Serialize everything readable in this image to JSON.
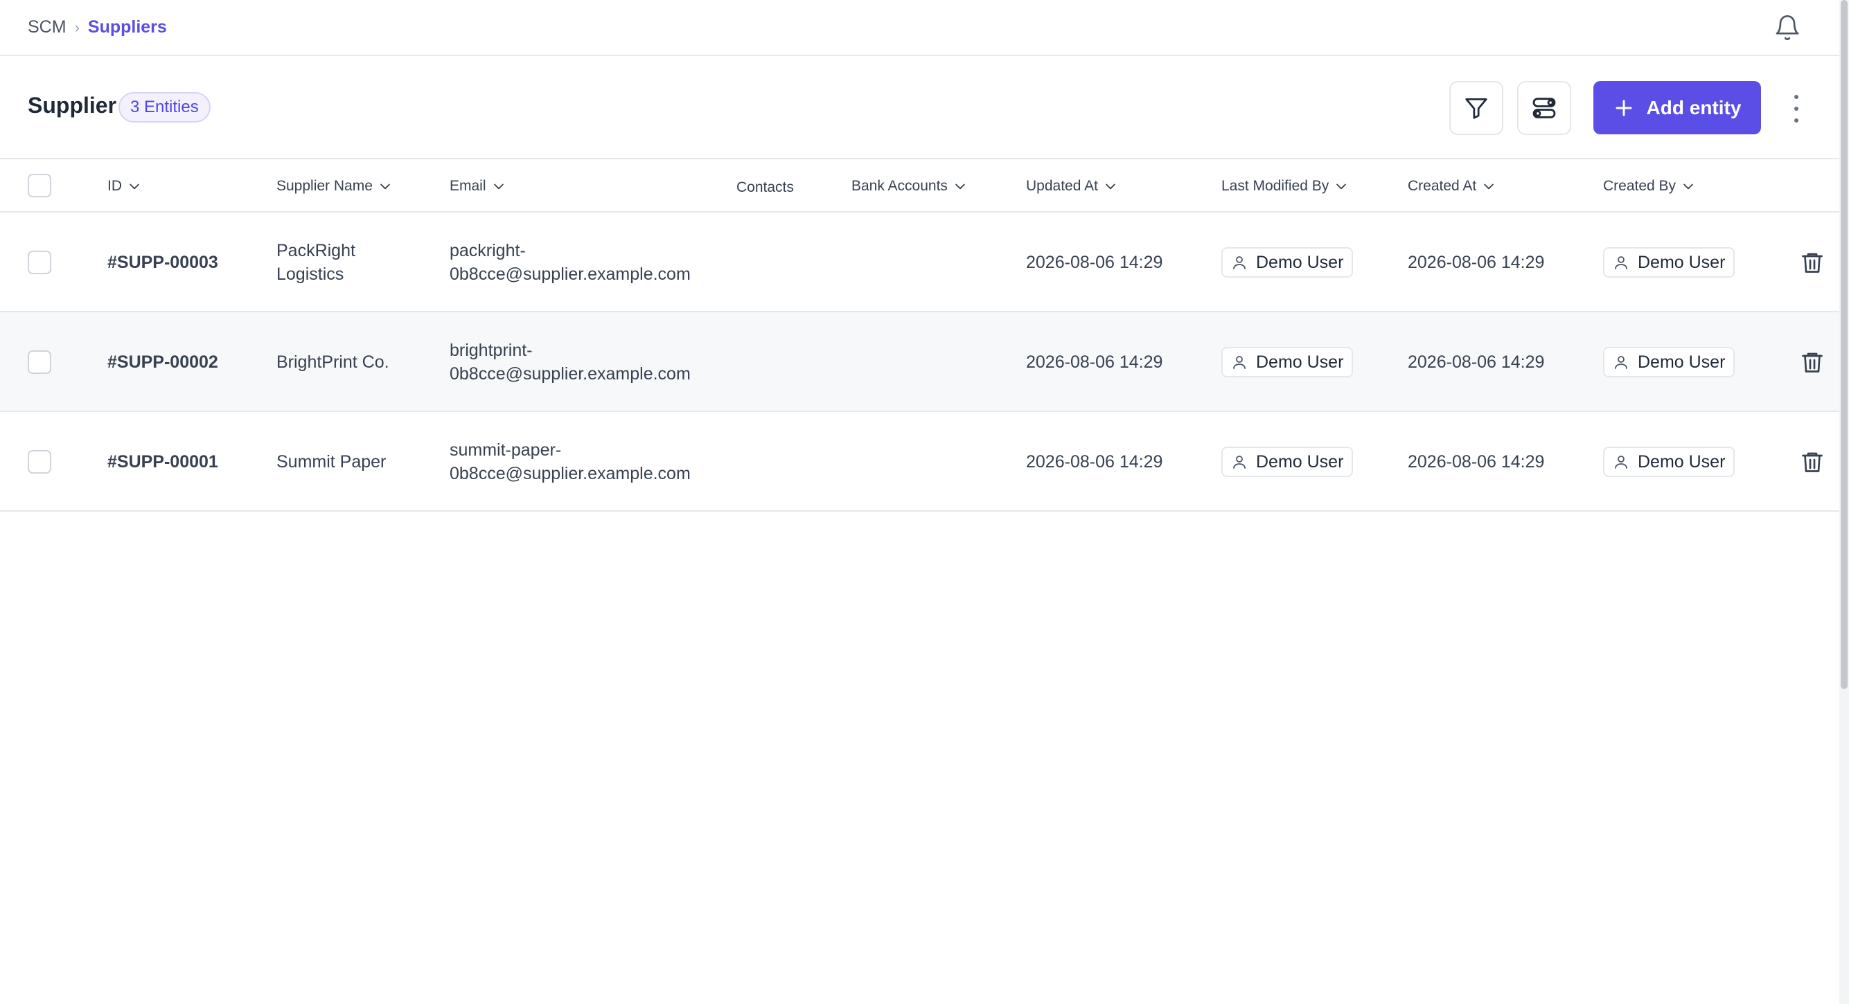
{
  "breadcrumb": {
    "root": "SCM",
    "separator": "›",
    "current": "Suppliers"
  },
  "page": {
    "title": "Supplier",
    "entity_count": "3 Entities"
  },
  "toolbar": {
    "add_label": "Add entity"
  },
  "columns": {
    "id": "ID",
    "supplier_name": "Supplier Name",
    "email": "Email",
    "contacts": "Contacts",
    "bank_accounts": "Bank Accounts",
    "updated_at": "Updated At",
    "last_modified_by": "Last Modified By",
    "created_at": "Created At",
    "created_by": "Created By"
  },
  "rows": [
    {
      "id": "#SUPP-00003",
      "name_line1": "PackRight",
      "name_line2": "Logistics",
      "email_line1": "packright-",
      "email_line2": "0b8cce@supplier.example.com",
      "updated_at": "2026-08-06 14:29",
      "last_modified_by": "Demo User",
      "created_at": "2026-08-06 14:29",
      "created_by": "Demo User"
    },
    {
      "id": "#SUPP-00002",
      "name_line1": "BrightPrint Co.",
      "name_line2": "",
      "email_line1": "brightprint-",
      "email_line2": "0b8cce@supplier.example.com",
      "updated_at": "2026-08-06 14:29",
      "last_modified_by": "Demo User",
      "created_at": "2026-08-06 14:29",
      "created_by": "Demo User"
    },
    {
      "id": "#SUPP-00001",
      "name_line1": "Summit Paper",
      "name_line2": "",
      "email_line1": "summit-paper-",
      "email_line2": "0b8cce@supplier.example.com",
      "updated_at": "2026-08-06 14:29",
      "last_modified_by": "Demo User",
      "created_at": "2026-08-06 14:29",
      "created_by": "Demo User"
    }
  ],
  "colors": {
    "accent": "#5b4ee6",
    "border": "#e5e7eb",
    "alt_row": "#f7f8f9"
  }
}
